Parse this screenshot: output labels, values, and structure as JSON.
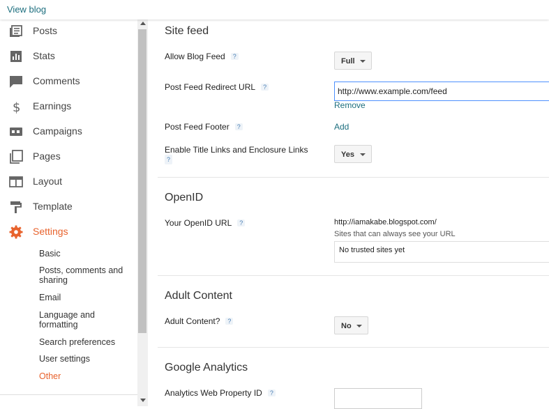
{
  "header": {
    "view_blog": "View blog"
  },
  "sidebar": {
    "items": [
      {
        "label": "Posts",
        "icon": "posts-icon"
      },
      {
        "label": "Stats",
        "icon": "stats-icon"
      },
      {
        "label": "Comments",
        "icon": "comments-icon"
      },
      {
        "label": "Earnings",
        "icon": "dollar-icon"
      },
      {
        "label": "Campaigns",
        "icon": "campaigns-icon"
      },
      {
        "label": "Pages",
        "icon": "pages-icon"
      },
      {
        "label": "Layout",
        "icon": "layout-icon"
      },
      {
        "label": "Template",
        "icon": "paint-roller-icon"
      },
      {
        "label": "Settings",
        "icon": "gear-icon"
      }
    ],
    "subitems": [
      {
        "label": "Basic"
      },
      {
        "label": "Posts, comments and sharing"
      },
      {
        "label": "Email"
      },
      {
        "label": "Language and formatting"
      },
      {
        "label": "Search preferences"
      },
      {
        "label": "User settings"
      },
      {
        "label": "Other"
      }
    ],
    "active_color": "#e8622c"
  },
  "help_symbol": "?",
  "site_feed": {
    "title": "Site feed",
    "allow_blog_feed": {
      "label": "Allow Blog Feed",
      "value": "Full"
    },
    "redirect_url": {
      "label": "Post Feed Redirect URL",
      "value": "http://www.example.com/feed",
      "remove": "Remove"
    },
    "footer": {
      "label": "Post Feed Footer",
      "add": "Add"
    },
    "title_links": {
      "label": "Enable Title Links and Enclosure Links",
      "value": "Yes"
    }
  },
  "openid": {
    "title": "OpenID",
    "url_label": "Your OpenID URL",
    "url_value": "http://iamakabe.blogspot.com/",
    "sites_note": "Sites that can always see your URL",
    "no_sites": "No trusted sites yet"
  },
  "adult": {
    "title": "Adult Content",
    "label": "Adult Content?",
    "value": "No"
  },
  "analytics": {
    "title": "Google Analytics",
    "label": "Analytics Web Property ID",
    "value": ""
  }
}
